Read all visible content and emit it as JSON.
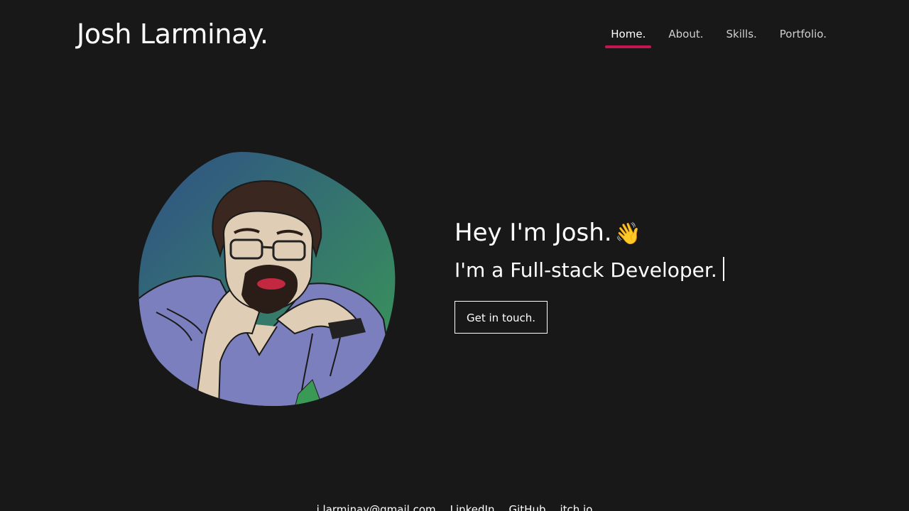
{
  "header": {
    "title": "Josh Larminay.",
    "nav": [
      {
        "label": "Home.",
        "active": true
      },
      {
        "label": "About.",
        "active": false
      },
      {
        "label": "Skills.",
        "active": false
      },
      {
        "label": "Portfolio.",
        "active": false
      }
    ],
    "accent_color": "#c2184f"
  },
  "hero": {
    "greeting": "Hey I'm Josh.",
    "wave_icon": "waving-hand-icon",
    "role": "I'm a Full-stack Developer.",
    "cta_label": "Get in touch."
  },
  "avatar": {
    "description_icon": "avatar-illustration",
    "gradient": [
      "#2f4f87",
      "#3a9a55"
    ],
    "shirt_color": "#7b7fbd"
  },
  "footer": {
    "links": [
      "j.larminay@gmail.com",
      "LinkedIn",
      "GitHub",
      "itch.io"
    ]
  },
  "colors": {
    "background": "#181818",
    "text": "#ffffff",
    "nav_inactive": "#cfcfcf"
  }
}
